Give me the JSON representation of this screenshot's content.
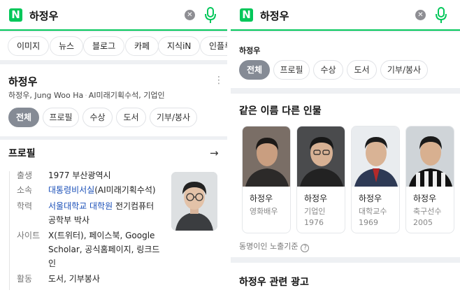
{
  "left": {
    "search": {
      "logo": "N",
      "query": "하정우",
      "clear_icon": "clear-icon",
      "mic_icon": "mic-icon"
    },
    "tabs": [
      "이미지",
      "뉴스",
      "블로그",
      "카페",
      "지식iN",
      "인플루"
    ],
    "entity": {
      "name": "하정우",
      "subtitle_name": "하정우, Jung Woo Ha",
      "subtitle_desc": "AI미래기획수석, 기업인"
    },
    "filters": [
      "전체",
      "프로필",
      "수상",
      "도서",
      "기부/봉사"
    ],
    "profile": {
      "title": "프로필",
      "rows": [
        {
          "key": "출생",
          "value": "1977 부산광역시"
        },
        {
          "key": "소속",
          "value_link": "대통령비서실",
          "value_rest": "(AI미래기획수석)"
        },
        {
          "key": "학력",
          "value_link": "서울대학교 대학원",
          "value_rest": " 전기컴퓨터 공학부 박사"
        },
        {
          "key": "사이트",
          "value_link": "X(트위터), 페이스북, Google Scholar, 공식홈페이지, 링크드인"
        },
        {
          "key": "활동",
          "value_link": "도서, 기부봉사"
        }
      ]
    }
  },
  "right": {
    "search": {
      "logo": "N",
      "query": "하정우"
    },
    "profile_name": "하정우",
    "filters": [
      "전체",
      "프로필",
      "수상",
      "도서",
      "기부/봉사"
    ],
    "same_name": {
      "title": "같은 이름 다른 인물",
      "people": [
        {
          "name": "하정우",
          "role": "영화배우",
          "year": ""
        },
        {
          "name": "하정우",
          "role": "기업인",
          "year": "1976"
        },
        {
          "name": "하정우",
          "role": "대학교수",
          "year": "1969"
        },
        {
          "name": "하정우",
          "role": "축구선수",
          "year": "2005"
        }
      ],
      "footnote": "동명이인 노출기준"
    },
    "ad_title": "하정우 관련 광고"
  }
}
